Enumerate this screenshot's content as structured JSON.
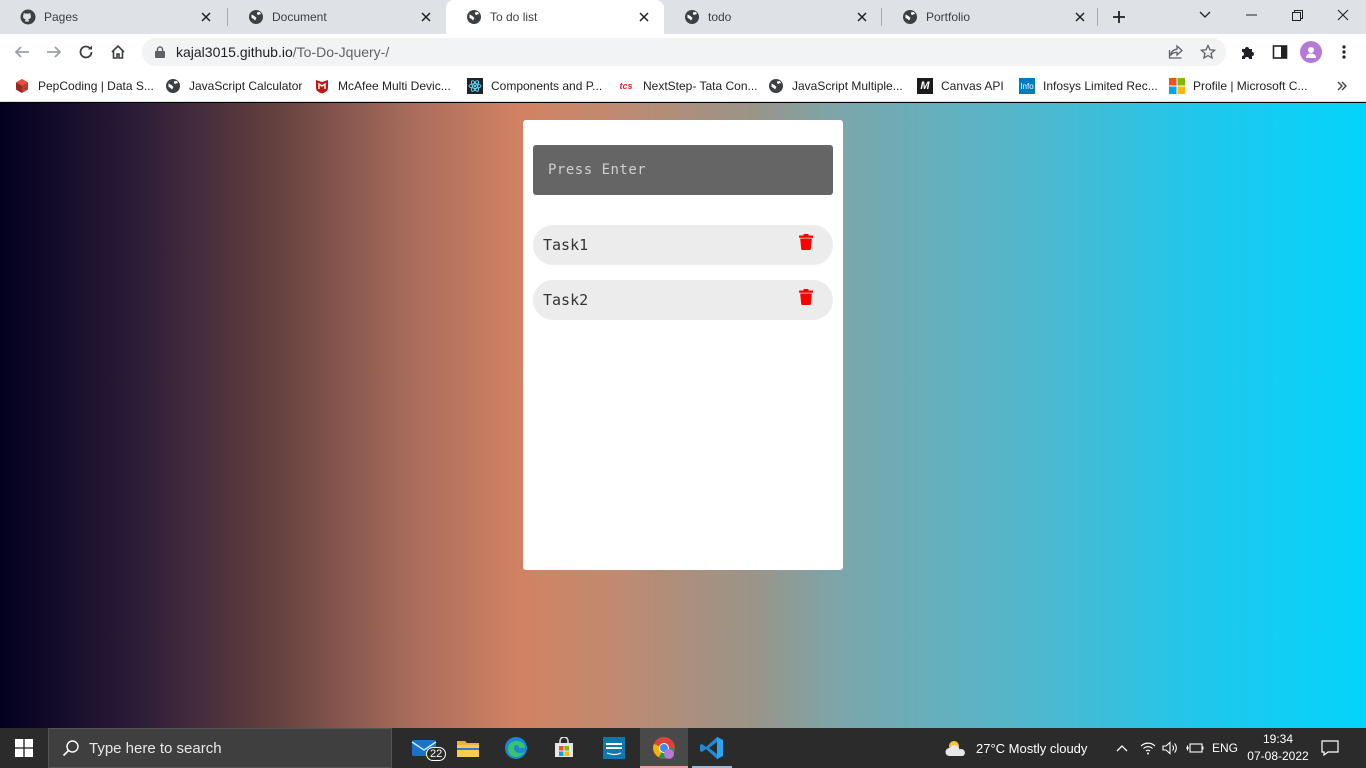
{
  "browser": {
    "tabs": [
      {
        "title": "Pages",
        "icon": "github-icon",
        "active": false
      },
      {
        "title": "Document",
        "icon": "globe-icon",
        "active": false
      },
      {
        "title": "To do list",
        "icon": "globe-icon",
        "active": true
      },
      {
        "title": "todo",
        "icon": "globe-icon",
        "active": false
      },
      {
        "title": "Portfolio",
        "icon": "globe-icon",
        "active": false
      }
    ],
    "address": {
      "host": "kajal3015.github.io",
      "path": "/To-Do-Jquery-/"
    },
    "bookmarks": [
      {
        "label": "PepCoding | Data S...",
        "icon": "pepcoding-icon"
      },
      {
        "label": "JavaScript Calculator",
        "icon": "globe-icon"
      },
      {
        "label": "McAfee Multi Devic...",
        "icon": "mcafee-icon"
      },
      {
        "label": "Components and P...",
        "icon": "react-icon"
      },
      {
        "label": "NextStep- Tata Con...",
        "icon": "tcs-icon"
      },
      {
        "label": "JavaScript Multiple...",
        "icon": "globe-icon"
      },
      {
        "label": "Canvas API",
        "icon": "mdn-icon"
      },
      {
        "label": "Infosys Limited Rec...",
        "icon": "infosys-icon"
      },
      {
        "label": "Profile | Microsoft C...",
        "icon": "microsoft-icon"
      }
    ],
    "bookmark_icon_text": {
      "tcs": "tcs",
      "mdn": "M",
      "infosys": "Info"
    }
  },
  "app": {
    "input_placeholder": "Press Enter",
    "tasks": [
      "Task1",
      "Task2"
    ]
  },
  "colors": {
    "trash": "#ff0000",
    "input_bg": "#656565",
    "task_bg": "#ececec"
  },
  "taskbar": {
    "search_placeholder": "Type here to search",
    "mail_badge": "22",
    "weather": "27°C  Mostly cloudy",
    "language": "ENG",
    "time": "19:34",
    "date": "07-08-2022"
  }
}
